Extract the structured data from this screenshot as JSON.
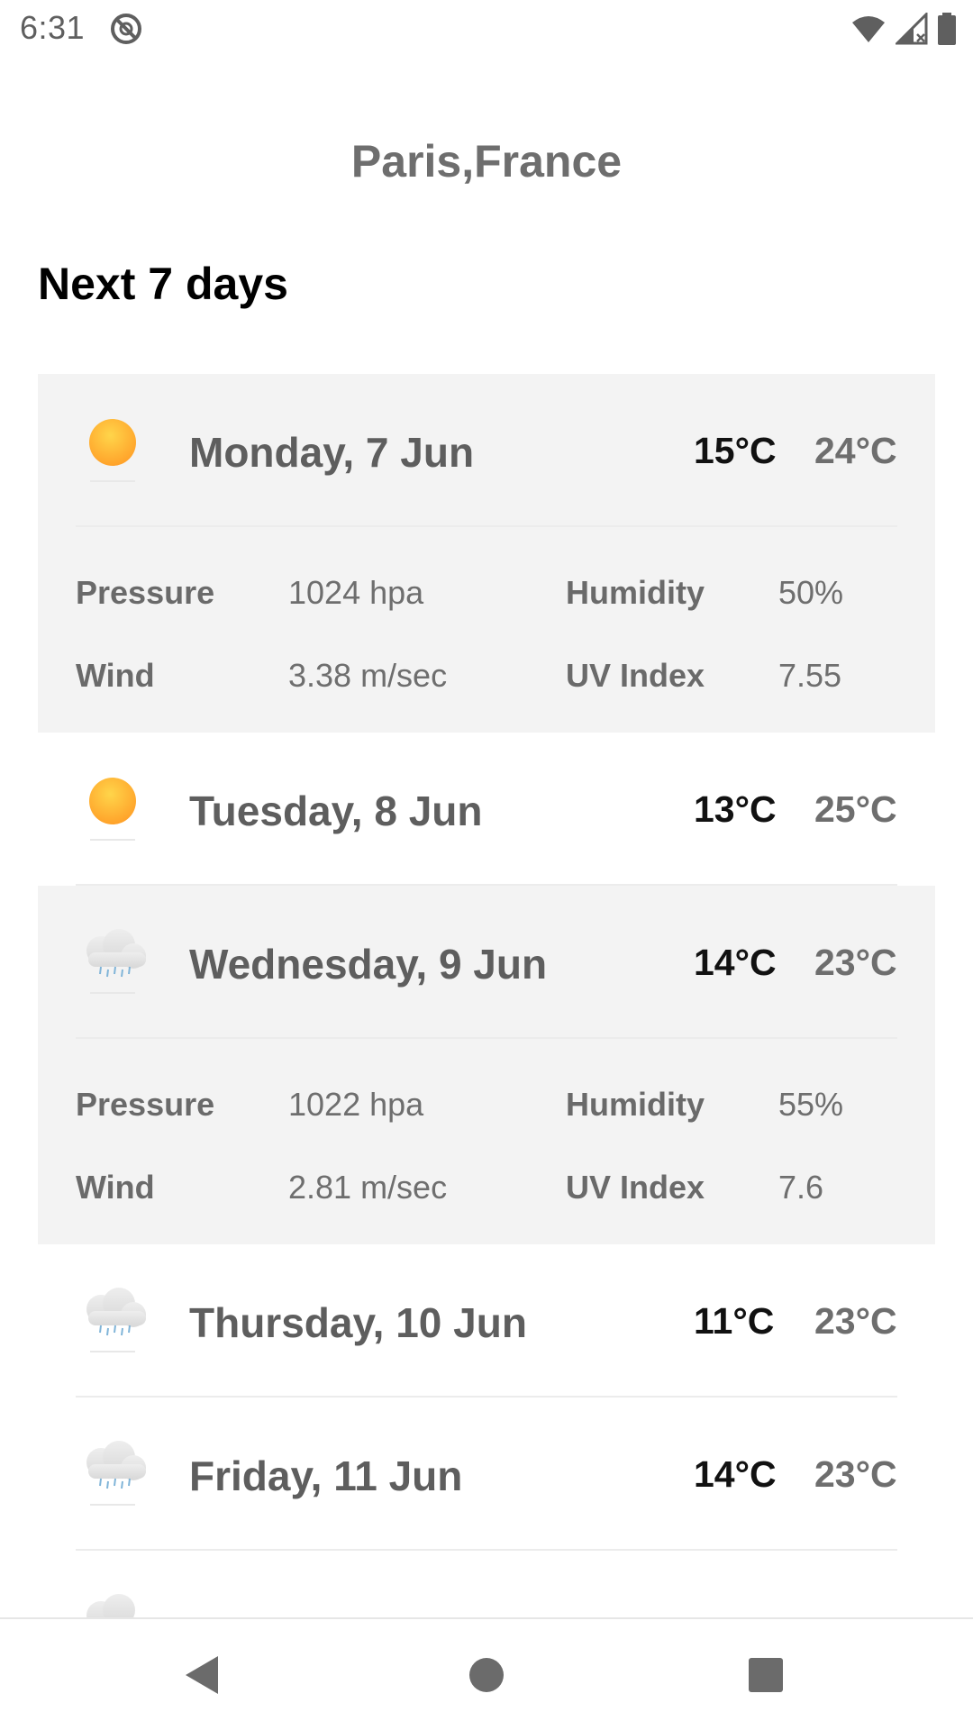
{
  "status_bar": {
    "time": "6:31"
  },
  "location": "Paris,France",
  "section_title": "Next 7 days",
  "detail_labels": {
    "pressure": "Pressure",
    "humidity": "Humidity",
    "wind": "Wind",
    "uv": "UV Index"
  },
  "days": [
    {
      "name": "Monday, 7 Jun",
      "min": "15°C",
      "max": "24°C",
      "icon": "sun-icon",
      "pressure": "1024 hpa",
      "humidity": "50%",
      "wind": "3.38 m/sec",
      "uv": "7.55"
    },
    {
      "name": "Tuesday, 8 Jun",
      "min": "13°C",
      "max": "25°C",
      "icon": "sun-icon"
    },
    {
      "name": "Wednesday, 9 Jun",
      "min": "14°C",
      "max": "23°C",
      "icon": "rain-cloud-icon",
      "pressure": "1022 hpa",
      "humidity": "55%",
      "wind": "2.81 m/sec",
      "uv": "7.6"
    },
    {
      "name": "Thursday, 10 Jun",
      "min": "11°C",
      "max": "23°C",
      "icon": "rain-cloud-icon"
    },
    {
      "name": "Friday, 11 Jun",
      "min": "14°C",
      "max": "23°C",
      "icon": "rain-cloud-icon"
    }
  ],
  "colors": {
    "expanded_background": "#f3f3f3",
    "sun": "#ffb830",
    "cloud": "#e2e2e2",
    "rain": "#7fb4d8"
  },
  "nav": {
    "back_icon": "back-triangle-icon",
    "home_icon": "home-circle-icon",
    "recents_icon": "recents-square-icon"
  }
}
